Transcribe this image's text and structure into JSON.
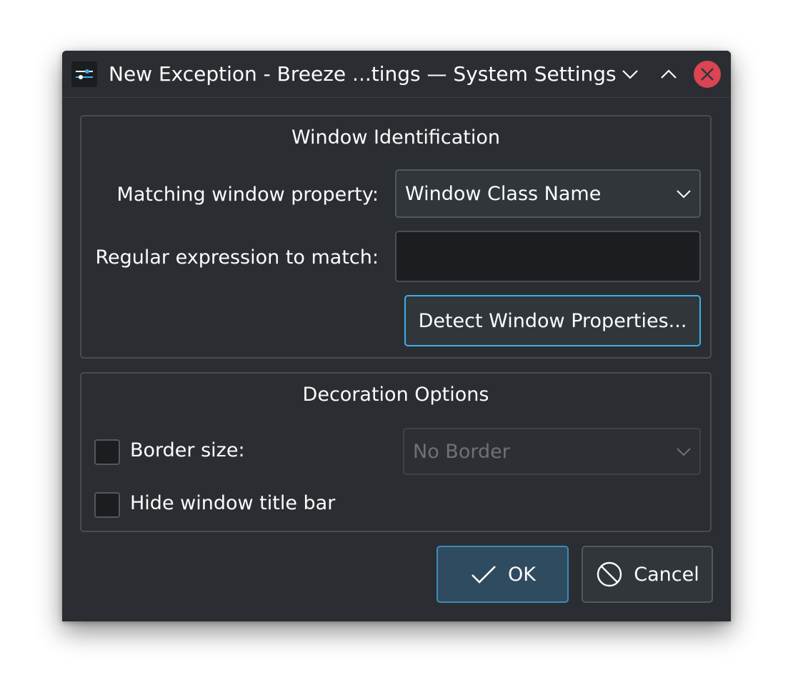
{
  "window": {
    "title": "New Exception - Breeze ...tings — System Settings",
    "icon": "system-settings-icon",
    "controls": {
      "minimize": "chevron-down-icon",
      "maximize": "chevron-up-icon",
      "close": "close-icon"
    },
    "colors": {
      "background": "#2a2e32",
      "accent": "#3daee9",
      "close": "#da4453"
    }
  },
  "identification": {
    "title": "Window Identification",
    "property_label": "Matching window property:",
    "property_value": "Window Class Name",
    "regex_label": "Regular expression to match:",
    "regex_value": "",
    "detect_button": "Detect Window Properties..."
  },
  "decoration": {
    "title": "Decoration Options",
    "border_size_label": "Border size:",
    "border_size_checked": false,
    "border_size_value": "No Border",
    "hide_titlebar_label": "Hide window title bar",
    "hide_titlebar_checked": false
  },
  "buttons": {
    "ok": "OK",
    "ok_icon": "checkmark-icon",
    "cancel": "Cancel",
    "cancel_icon": "cancel-icon"
  }
}
